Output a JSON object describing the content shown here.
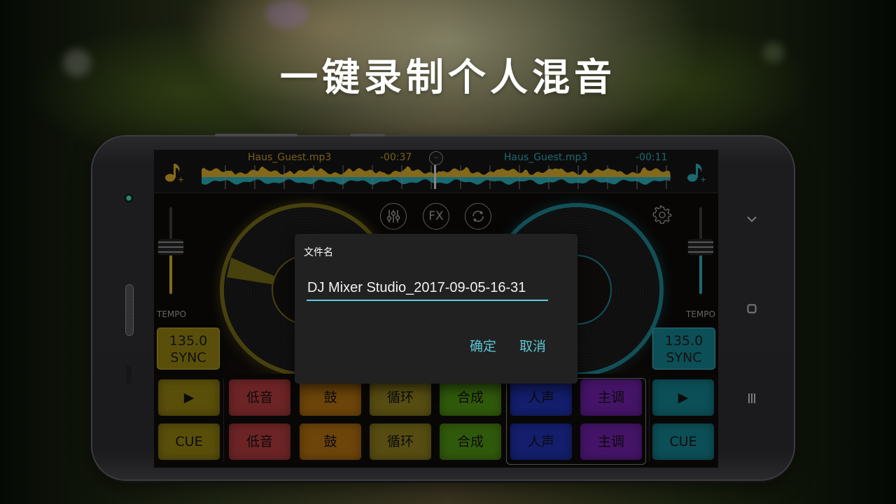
{
  "headline": "一键录制个人混音",
  "app": {
    "left_deck": {
      "track_name": "Haus_Guest.mp3",
      "time_remaining": "-00:37",
      "accent": "#c9a227",
      "tempo_label": "TEMPO",
      "tempo_position": 0.45,
      "bpm": "135.0",
      "sync_label": "SYNC"
    },
    "right_deck": {
      "track_name": "Haus_Guest.mp3",
      "time_remaining": "-00:11",
      "accent": "#27a3b0",
      "tempo_label": "TEMPO",
      "tempo_position": 0.45,
      "bpm": "135.0",
      "sync_label": "SYNC"
    },
    "center_buttons": [
      {
        "name": "mixer",
        "icon": "equalizer-sliders-icon"
      },
      {
        "name": "fx",
        "label": "FX",
        "icon": "fx-icon"
      },
      {
        "name": "sync-loop",
        "icon": "refresh-cycle-icon"
      }
    ],
    "settings_icon": "gear-icon",
    "add_song_icon": "music-note-plus-icon",
    "pads": {
      "left_transport": [
        {
          "label": "▶",
          "icon": "play-icon"
        },
        {
          "label": "CUE"
        }
      ],
      "right_transport": [
        {
          "label": "▶",
          "icon": "play-icon"
        },
        {
          "label": "CUE"
        }
      ],
      "sample_rows": [
        [
          "低音",
          "鼓",
          "循环",
          "合成",
          "人声",
          "主调"
        ],
        [
          "低音",
          "鼓",
          "循环",
          "合成",
          "人声",
          "主调"
        ]
      ],
      "colors": {
        "transport_left": "#8a7a10",
        "bass": "#a8383a",
        "drum": "#a86a10",
        "loop": "#86771c",
        "synth": "#4b8a12",
        "vocal": "#1f2fa8",
        "lead": "#6a1fa0",
        "transport_right": "#137a86"
      }
    }
  },
  "dialog": {
    "title": "文件名",
    "filename_value": "DJ Mixer Studio_2017-09-05-16-31",
    "confirm_label": "确定",
    "cancel_label": "取消",
    "accent": "#5cc6d3"
  },
  "system_nav": {
    "back_icon": "chevron-down-icon",
    "home_icon": "square-home-icon",
    "recents_icon": "three-bars-menu-icon"
  }
}
